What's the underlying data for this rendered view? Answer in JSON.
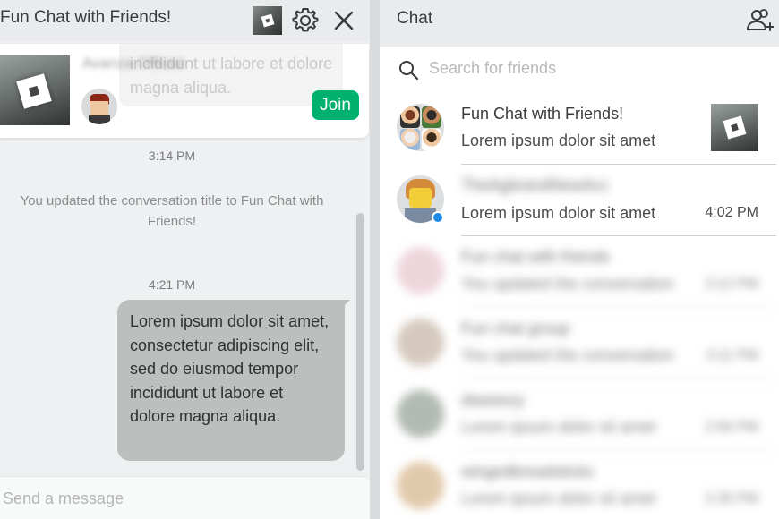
{
  "chat_window": {
    "title": "Fun Chat with Friends!",
    "icons": {
      "thumbnail": "game-thumbnail-icon",
      "settings": "gear-icon",
      "close": "close-icon"
    },
    "game_card": {
      "user_name": "Avanza Official",
      "bubble_text": "incididunt ut labore et dolore magna aliqua.",
      "join_label": "Join"
    },
    "messages": [
      {
        "type": "timestamp",
        "text": "3:14 PM"
      },
      {
        "type": "system",
        "text": "You updated the conversation title to Fun Chat with Friends!"
      },
      {
        "type": "timestamp",
        "text": "4:21 PM"
      },
      {
        "type": "outgoing",
        "text": "Lorem ipsum dolor sit amet, consectetur adipiscing elit, sed do eiusmod tempor incididunt ut labore et dolore magna aliqua."
      }
    ],
    "composer": {
      "placeholder": "Send a message"
    }
  },
  "chat_list": {
    "title": "Chat",
    "add_friend_icon": "add-friends-icon",
    "search": {
      "placeholder": "Search for friends",
      "icon": "search-icon"
    },
    "conversations": [
      {
        "name": "Fun Chat with Friends!",
        "preview": "Lorem ipsum dolor sit amet",
        "time": ""
      },
      {
        "name": "TheAgbrandNewAcc",
        "preview": "Lorem ipsum dolor sit amet",
        "time": "4:02 PM",
        "online": true
      },
      {
        "name": "Fun chat with friends",
        "preview": "You updated the conversation",
        "time": "3:12 PM"
      },
      {
        "name": "Fun chat group",
        "preview": "You updated the conversation",
        "time": "3:11 PM"
      },
      {
        "name": "daweezy",
        "preview": "Lorem ipsum dolor sit amet",
        "time": "2:56 PM"
      },
      {
        "name": "wingedbreadsticks",
        "preview": "Lorem ipsum dolor sit amet",
        "time": "2:35 PM"
      }
    ]
  },
  "colors": {
    "join_button": "#00b06f",
    "online_dot": "#1e88e5",
    "outgoing_bubble": "#bdbebe"
  }
}
